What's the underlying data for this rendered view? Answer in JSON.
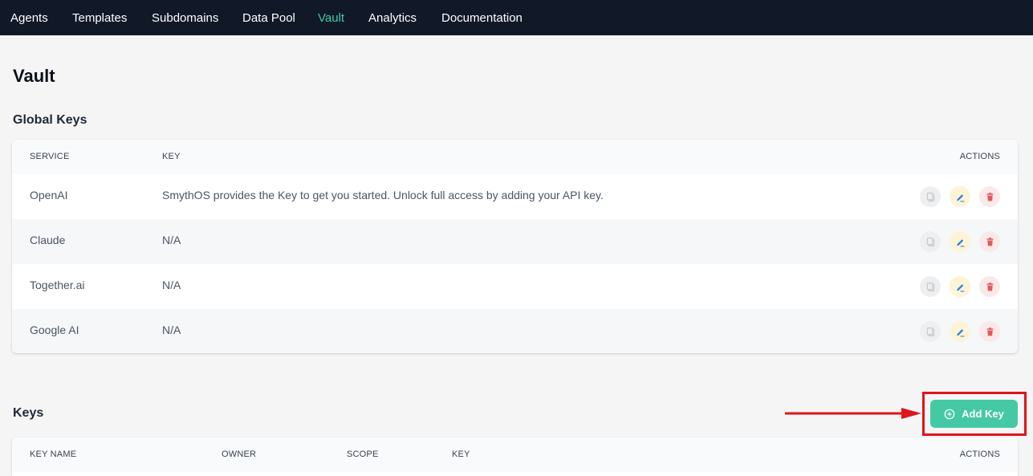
{
  "nav": {
    "items": [
      {
        "label": "Agents"
      },
      {
        "label": "Templates"
      },
      {
        "label": "Subdomains"
      },
      {
        "label": "Data Pool"
      },
      {
        "label": "Vault"
      },
      {
        "label": "Analytics"
      },
      {
        "label": "Documentation"
      }
    ],
    "active": "Vault"
  },
  "page": {
    "title": "Vault"
  },
  "global_keys": {
    "title": "Global Keys",
    "columns": {
      "service": "SERVICE",
      "key": "KEY",
      "actions": "ACTIONS"
    },
    "rows": [
      {
        "service": "OpenAI",
        "key": "SmythOS provides the Key to get you started. Unlock full access by adding your API key."
      },
      {
        "service": "Claude",
        "key": "N/A"
      },
      {
        "service": "Together.ai",
        "key": "N/A"
      },
      {
        "service": "Google AI",
        "key": "N/A"
      }
    ]
  },
  "keys": {
    "title": "Keys",
    "add_button": "Add Key",
    "columns": {
      "key_name": "KEY NAME",
      "owner": "OWNER",
      "scope": "SCOPE",
      "key": "KEY",
      "actions": "ACTIONS"
    }
  },
  "icons": {
    "copy": "copy-icon",
    "edit": "pencil-icon",
    "delete": "trash-icon",
    "add": "plus-circle-icon",
    "annotation": "arrow-right-icon"
  },
  "colors": {
    "nav_bg": "#111827",
    "active_nav": "#45c9a5",
    "accent": "#45c9a5",
    "highlight": "#e0141b",
    "edit_icon": "#2f7fd8",
    "delete_icon": "#e05a61"
  }
}
